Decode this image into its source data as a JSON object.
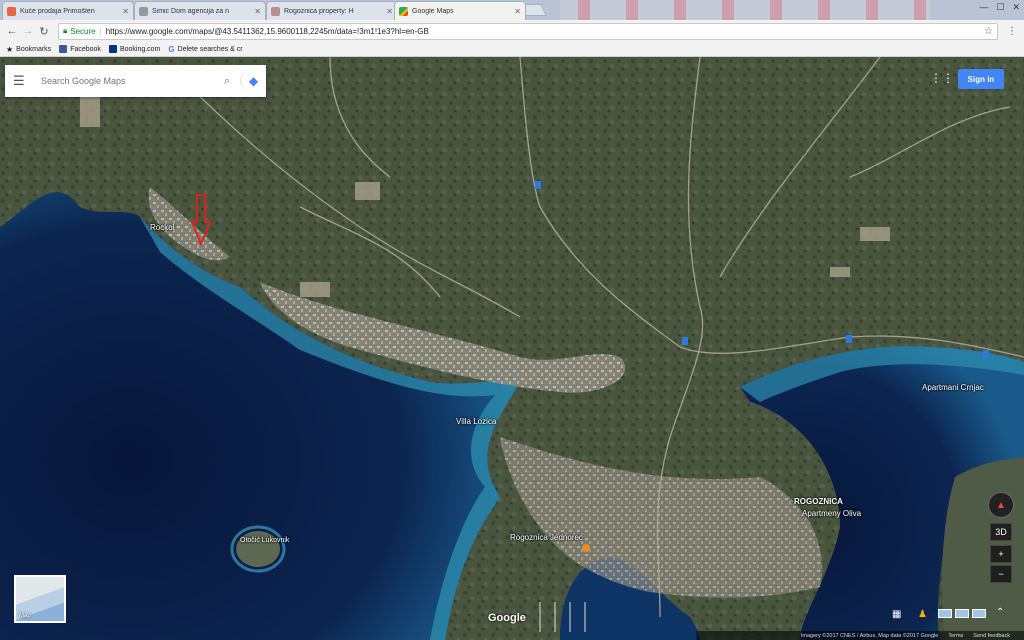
{
  "browser": {
    "tabs": [
      {
        "label": "Kuće prodaja Primošten",
        "color": "#e8663b",
        "active": false
      },
      {
        "label": "Simic Dom agencija za n",
        "color": "#999999",
        "active": false
      },
      {
        "label": "Rogoznica property: H",
        "color": "#b68f8f",
        "active": false
      },
      {
        "label": "Google Maps",
        "color": "#34a853",
        "active": true
      }
    ],
    "address": {
      "secure_label": "Secure",
      "url": "https://www.google.com/maps/@43.5411362,15.9600118,2245m/data=!3m1!1e3?hl=en-GB"
    },
    "bookmarks": [
      {
        "label": "Bookmarks",
        "icon": "star-icon",
        "color": "#555555"
      },
      {
        "label": "Facebook",
        "icon": "facebook-icon",
        "color": "#3b5998"
      },
      {
        "label": "Booking.com",
        "icon": "booking-icon",
        "color": "#003580"
      },
      {
        "label": "Delete searches & cr",
        "icon": "google-icon",
        "color": "#ffffff"
      }
    ]
  },
  "maps": {
    "search_placeholder": "Search Google Maps",
    "signin_label": "Sign in",
    "minimap_label": "Map",
    "labels": [
      {
        "text": "Rockol"
      },
      {
        "text": "Villa Lozica"
      },
      {
        "text": "Apartmani Crnjac"
      },
      {
        "text": "ROGOZNICA"
      },
      {
        "text": "Apartmeny Oliva"
      },
      {
        "text": "Otočić Lukovnik"
      },
      {
        "text": "Rogoznica Jednorec"
      }
    ],
    "zoom_3d": "3D",
    "zoom_in": "+",
    "zoom_out": "−",
    "google_label": "Google",
    "footer": {
      "imagery": "Imagery ©2017 CNES / Airbus, Map data ©2017 Google",
      "terms": "Terms",
      "feedback": "Send feedback"
    }
  },
  "colors": {
    "sea_deep": "#0a1d3f",
    "sea_shallow": "#2e8fb0",
    "land": "#4a5546",
    "accent": "#4285f4"
  }
}
